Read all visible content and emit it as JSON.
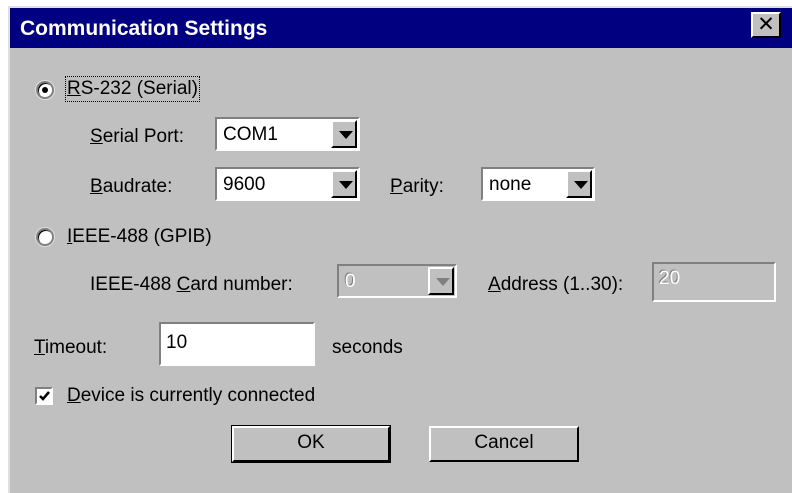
{
  "window": {
    "title": "Communication Settings",
    "close_glyph": "✕"
  },
  "rs232": {
    "radio_prefix_u": "R",
    "radio_rest": "S-232 (Serial)",
    "selected": true,
    "serial_port": {
      "label_u": "S",
      "label_rest": "erial Port:",
      "value": "COM1"
    },
    "baudrate": {
      "label_u": "B",
      "label_rest": "audrate:",
      "value": "9600"
    },
    "parity": {
      "label_u": "P",
      "label_rest": "arity:",
      "value": "none"
    }
  },
  "gpib": {
    "radio_prefix_u": "I",
    "radio_rest": "EEE-488 (GPIB)",
    "selected": false,
    "card": {
      "label_pre": "IEEE-488 ",
      "label_u": "C",
      "label_rest": "ard number:",
      "value": "0"
    },
    "address": {
      "label_u": "A",
      "label_rest": "ddress (1..30):",
      "value": "20"
    }
  },
  "timeout": {
    "label_u": "T",
    "label_rest": "imeout:",
    "value": "10",
    "unit": "seconds"
  },
  "connected": {
    "label_u": "D",
    "label_rest": "evice is currently connected",
    "checked": true
  },
  "buttons": {
    "ok": "OK",
    "cancel": "Cancel"
  }
}
